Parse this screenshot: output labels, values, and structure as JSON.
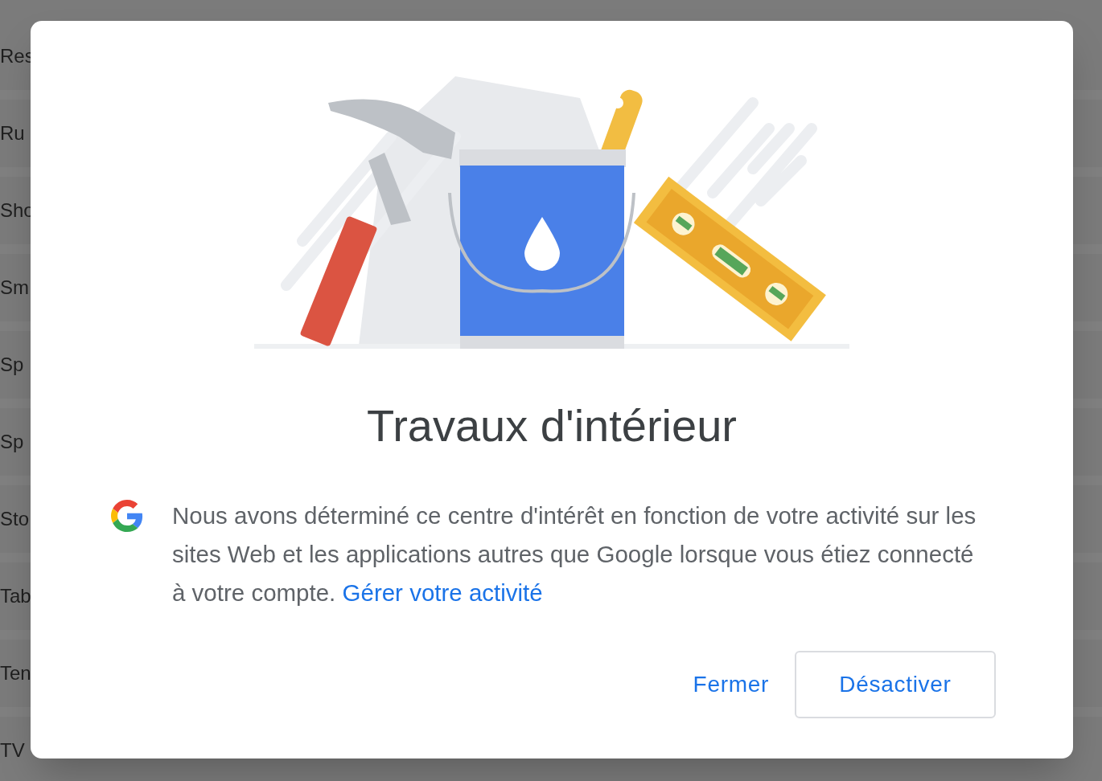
{
  "background_list": {
    "items": [
      "Res",
      "Ru",
      "Sho",
      "Sm",
      "Sp",
      "Sp",
      "Sto",
      "Tab",
      "Ten",
      "TV"
    ]
  },
  "dialog": {
    "title": "Travaux d'intérieur",
    "body": "Nous avons déterminé ce centre d'intérêt en fonction de votre activité sur les sites Web et les applications autres que Google lorsque vous étiez connecté à votre compte.",
    "link": "Gérer votre activité",
    "buttons": [
      {
        "label": "Fermer",
        "kind": "text"
      },
      {
        "label": "Désactiver",
        "kind": "outlined"
      }
    ]
  }
}
